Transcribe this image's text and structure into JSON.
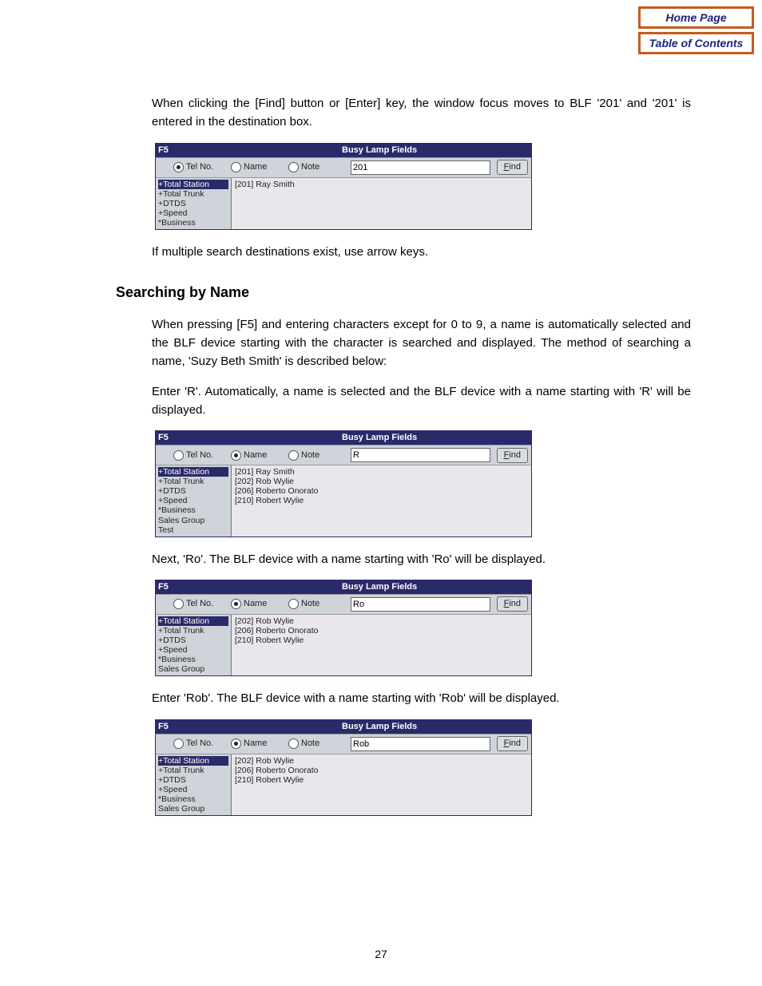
{
  "nav": {
    "home": "Home Page",
    "toc": "Table of Contents"
  },
  "page_number": "27",
  "intro_para": "When clicking the [Find] button or [Enter] key, the window focus moves to BLF '201' and '201' is entered in the destination box.",
  "after_fig1": "If multiple search destinations exist, use arrow keys.",
  "section_heading": "Searching by Name",
  "section_para": "When pressing [F5] and entering characters except for 0 to 9, a name is automatically selected and the BLF device starting with the character is searched and displayed. The method of searching a name, 'Suzy Beth Smith' is described below:",
  "step_r": "Enter 'R'. Automatically, a name is selected and the BLF device with a name starting with 'R' will be displayed.",
  "step_ro": "Next, 'Ro'. The BLF device with a name starting with 'Ro' will be displayed.",
  "step_rob": "Enter 'Rob'. The BLF device with a name starting with 'Rob' will be displayed.",
  "blf_labels": {
    "title_left": "F5",
    "title_right": "Busy Lamp Fields",
    "radio_telno": "Tel No.",
    "radio_name": "Name",
    "radio_note": "Note",
    "find": "Find"
  },
  "fig1": {
    "selected_radio": "telno",
    "input": "201",
    "tree": [
      "+Total Station",
      "+Total Trunk",
      "+DTDS",
      "+Speed",
      "*Business"
    ],
    "tree_selected_index": 0,
    "results": [
      "[201] Ray Smith"
    ]
  },
  "fig2": {
    "selected_radio": "name",
    "input": "R",
    "tree": [
      "+Total Station",
      "+Total Trunk",
      "+DTDS",
      "+Speed",
      "*Business",
      " Sales Group",
      " Test"
    ],
    "tree_selected_index": 0,
    "results": [
      "[201] Ray Smith",
      "[202] Rob Wylie",
      "[206] Roberto Onorato",
      "[210] Robert Wylie"
    ]
  },
  "fig3": {
    "selected_radio": "name",
    "input": "Ro",
    "tree": [
      "+Total Station",
      "+Total Trunk",
      "+DTDS",
      "+Speed",
      "*Business",
      " Sales Group"
    ],
    "tree_selected_index": 0,
    "results": [
      "[202] Rob Wylie",
      "[206] Roberto Onorato",
      "[210] Robert Wylie"
    ]
  },
  "fig4": {
    "selected_radio": "name",
    "input": "Rob",
    "tree": [
      "+Total Station",
      "+Total Trunk",
      "+DTDS",
      "+Speed",
      "*Business",
      " Sales Group"
    ],
    "tree_selected_index": 0,
    "results": [
      "[202] Rob Wylie",
      "[206] Roberto Onorato",
      "[210] Robert Wylie"
    ]
  }
}
